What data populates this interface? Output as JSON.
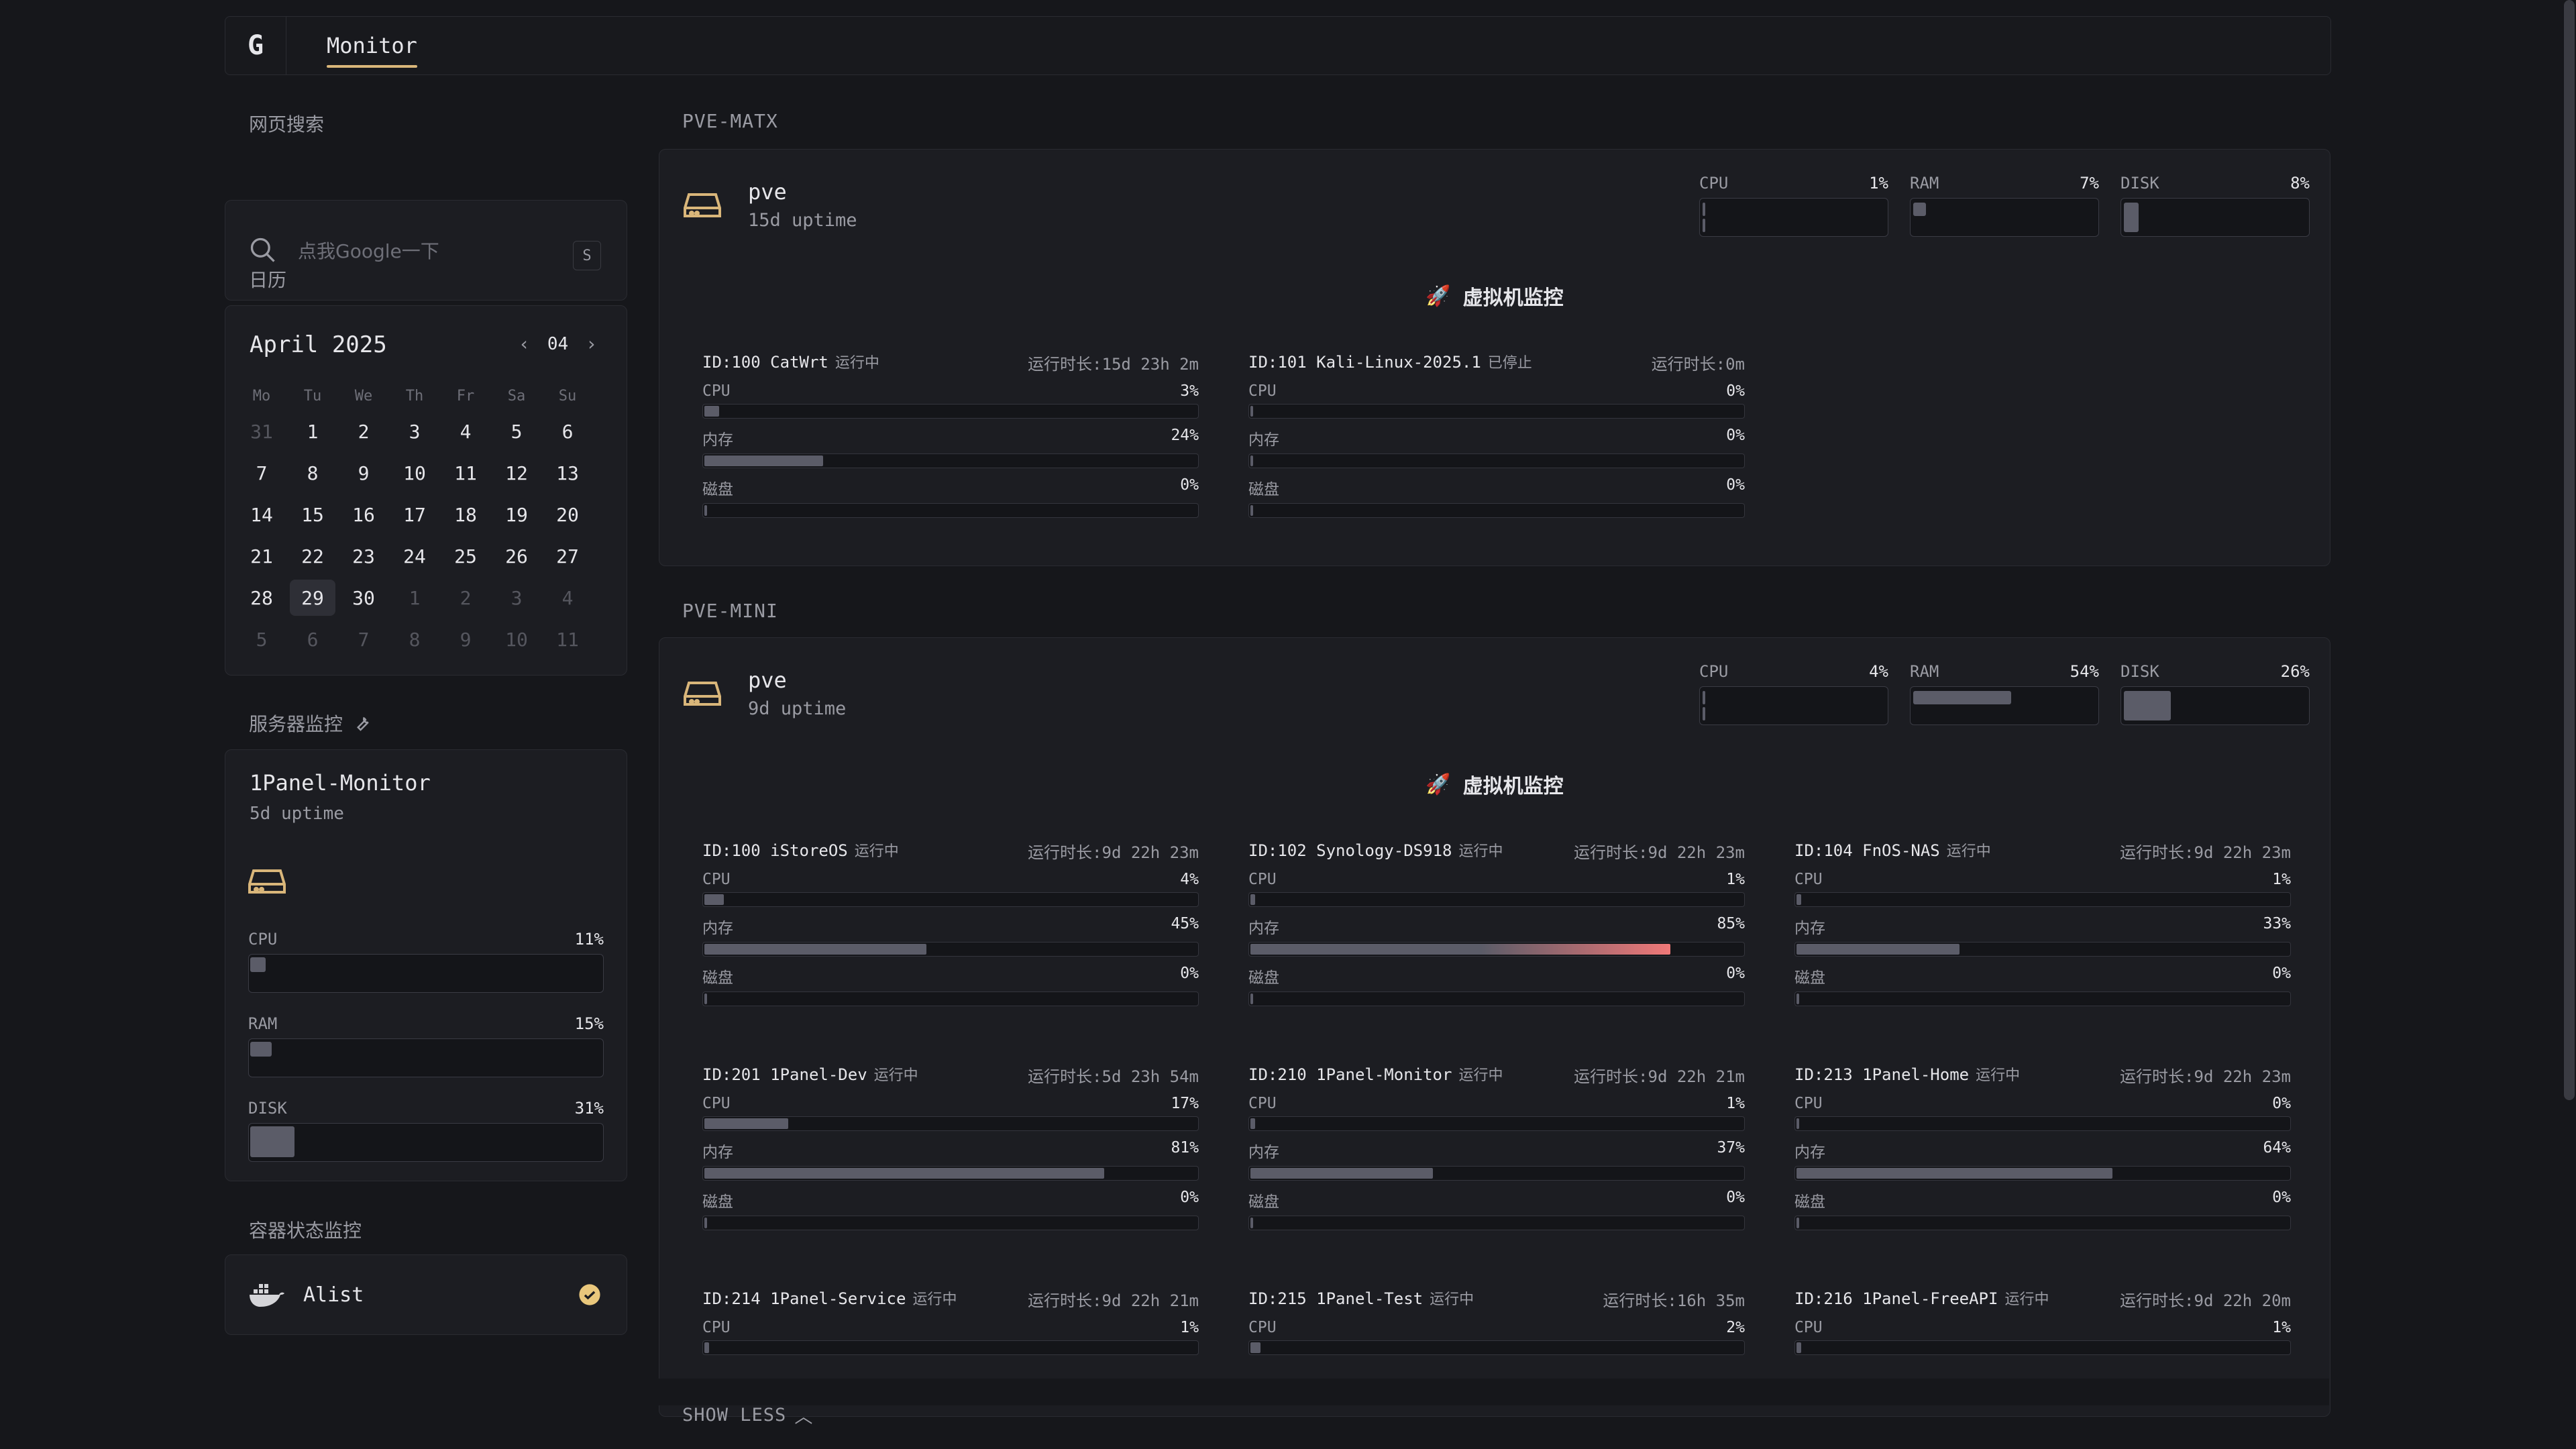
{
  "app": {
    "logo": "G",
    "tab": "Monitor"
  },
  "sidebar": {
    "search": {
      "title": "网页搜索",
      "placeholder": "点我Google一下",
      "shortcut": "S"
    },
    "calendar": {
      "title": "日历",
      "month_label": "April 2025",
      "month_num": "04",
      "weekdays": [
        "Mo",
        "Tu",
        "We",
        "Th",
        "Fr",
        "Sa",
        "Su"
      ],
      "weeks": [
        [
          "31",
          "1",
          "2",
          "3",
          "4",
          "5",
          "6"
        ],
        [
          "7",
          "8",
          "9",
          "10",
          "11",
          "12",
          "13"
        ],
        [
          "14",
          "15",
          "16",
          "17",
          "18",
          "19",
          "20"
        ],
        [
          "21",
          "22",
          "23",
          "24",
          "25",
          "26",
          "27"
        ],
        [
          "28",
          "29",
          "30",
          "1",
          "2",
          "3",
          "4"
        ],
        [
          "5",
          "6",
          "7",
          "8",
          "9",
          "10",
          "11"
        ]
      ],
      "today": "29"
    },
    "server": {
      "title": "服务器监控",
      "name": "1Panel-Monitor",
      "uptime": "5d uptime",
      "metrics": [
        {
          "label": "CPU",
          "value": 11,
          "unit": "%"
        },
        {
          "label": "RAM",
          "value": 15,
          "unit": "%"
        },
        {
          "label": "DISK",
          "value": 31,
          "unit": "%"
        }
      ]
    },
    "containers": {
      "title": "容器状态监控",
      "items": [
        {
          "name": "Alist",
          "status": "ok"
        }
      ]
    }
  },
  "groups": [
    {
      "title": "PVE-MATX",
      "host": {
        "name": "pve",
        "uptime": "15d uptime",
        "metrics": [
          {
            "label": "CPU",
            "value": 1,
            "unit": "%"
          },
          {
            "label": "RAM",
            "value": 7,
            "unit": "%"
          },
          {
            "label": "DISK",
            "value": 8,
            "unit": "%"
          }
        ]
      },
      "vm_title": "虚拟机监控",
      "vms": [
        {
          "id": "ID:100",
          "name": "CatWrt",
          "status": "运行中",
          "runtime": "运行时长:15d 23h 2m",
          "cpu": 3,
          "mem": 24,
          "disk": 0
        },
        {
          "id": "ID:101",
          "name": "Kali-Linux-2025.1",
          "status": "已停止",
          "runtime": "运行时长:0m",
          "cpu": 0,
          "mem": 0,
          "disk": 0
        }
      ]
    },
    {
      "title": "PVE-MINI",
      "host": {
        "name": "pve",
        "uptime": "9d uptime",
        "metrics": [
          {
            "label": "CPU",
            "value": 4,
            "unit": "%"
          },
          {
            "label": "RAM",
            "value": 54,
            "unit": "%"
          },
          {
            "label": "DISK",
            "value": 26,
            "unit": "%"
          }
        ]
      },
      "vm_title": "虚拟机监控",
      "vms": [
        {
          "id": "ID:100",
          "name": "iStoreOS",
          "status": "运行中",
          "runtime": "运行时长:9d 22h 23m",
          "cpu": 4,
          "mem": 45,
          "disk": 0
        },
        {
          "id": "ID:102",
          "name": "Synology-DS918",
          "status": "运行中",
          "runtime": "运行时长:9d 22h 23m",
          "cpu": 1,
          "mem": 85,
          "disk": 0
        },
        {
          "id": "ID:104",
          "name": "FnOS-NAS",
          "status": "运行中",
          "runtime": "运行时长:9d 22h 23m",
          "cpu": 1,
          "mem": 33,
          "disk": 0
        },
        {
          "id": "ID:201",
          "name": "1Panel-Dev",
          "status": "运行中",
          "runtime": "运行时长:5d 23h 54m",
          "cpu": 17,
          "mem": 81,
          "disk": 0
        },
        {
          "id": "ID:210",
          "name": "1Panel-Monitor",
          "status": "运行中",
          "runtime": "运行时长:9d 22h 21m",
          "cpu": 1,
          "mem": 37,
          "disk": 0
        },
        {
          "id": "ID:213",
          "name": "1Panel-Home",
          "status": "运行中",
          "runtime": "运行时长:9d 22h 23m",
          "cpu": 0,
          "mem": 64,
          "disk": 0
        },
        {
          "id": "ID:214",
          "name": "1Panel-Service",
          "status": "运行中",
          "runtime": "运行时长:9d 22h 21m",
          "cpu": 1,
          "mem": null,
          "disk": null
        },
        {
          "id": "ID:215",
          "name": "1Panel-Test",
          "status": "运行中",
          "runtime": "运行时长:16h 35m",
          "cpu": 2,
          "mem": null,
          "disk": null
        },
        {
          "id": "ID:216",
          "name": "1Panel-FreeAPI",
          "status": "运行中",
          "runtime": "运行时长:9d 22h 20m",
          "cpu": 1,
          "mem": null,
          "disk": null
        }
      ]
    }
  ],
  "labels": {
    "cpu": "CPU",
    "mem": "内存",
    "disk": "磁盘",
    "pct": "%"
  },
  "show_less": "SHOW LESS",
  "colors": {
    "accent": "#d9b67a",
    "bar": "#5b5c68",
    "hot": "#f07878"
  }
}
